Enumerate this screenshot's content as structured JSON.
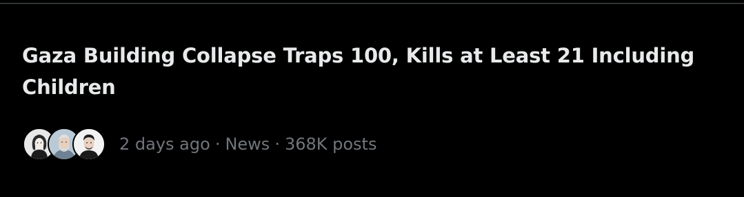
{
  "trend": {
    "headline": "Gaza Building Collapse Traps 100, Kills at Least 21 Including Children",
    "time_ago": "2 days ago",
    "category": "News",
    "post_count": "368K posts",
    "separator": "·"
  },
  "avatars": [
    {
      "name": "avatar-woman-dark-hair-icon"
    },
    {
      "name": "avatar-man-gray-beard-icon"
    },
    {
      "name": "avatar-man-dark-hair-icon"
    }
  ],
  "colors": {
    "background": "#000000",
    "headline_text": "#e7e9ea",
    "meta_text": "#71767b",
    "divider": "#2f3336"
  }
}
